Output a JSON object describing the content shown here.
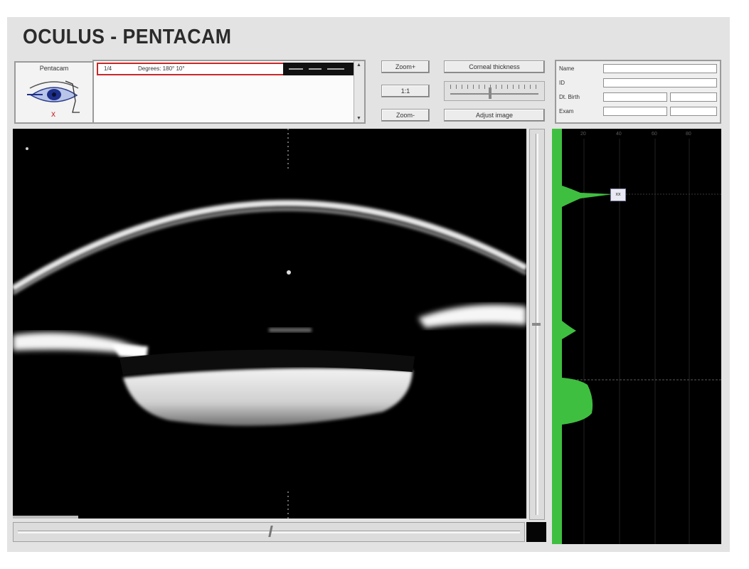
{
  "app": {
    "title": "OCULUS - PENTACAM"
  },
  "eye_selector": {
    "caption": "Pentacam",
    "eye_icon": "eye-icon",
    "mark": "x"
  },
  "scan_list": {
    "rows": [
      {
        "col1": "1/4",
        "col2": "Degrees: 180° 10°"
      }
    ]
  },
  "controls": {
    "zoom_in_label": "Zoom+",
    "one_one_label": "1:1",
    "zoom_out_label": "Zoom-",
    "corneal_label": "Corneal thickness",
    "adjust_label": "Adjust image"
  },
  "patient": {
    "labels": [
      "Name",
      "ID",
      "Dt. Birth",
      "Exam"
    ]
  },
  "density_graph": {
    "axis_ticks": [
      "20",
      "40",
      "60",
      "80"
    ],
    "marker_label": "xx",
    "curve_color": "#3fbf3f"
  },
  "colors": {
    "selection_border": "#c8282a",
    "window_bg": "#e3e3e3",
    "image_bg": "#000000"
  }
}
